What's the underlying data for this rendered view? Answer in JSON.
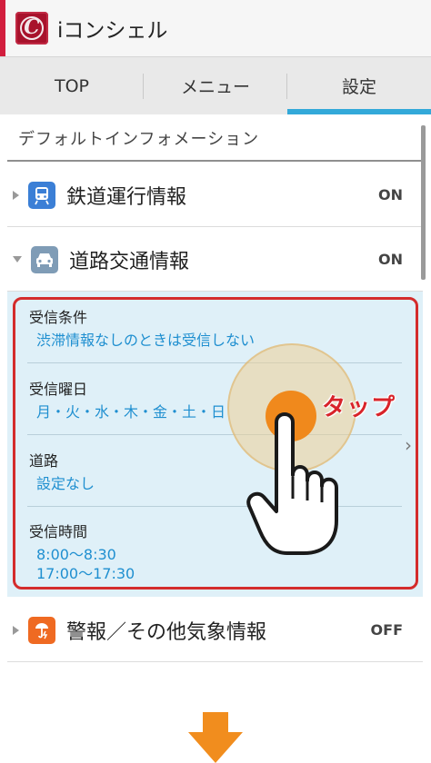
{
  "app": {
    "logo_letter": "C",
    "title": "iコンシェル"
  },
  "tabs": [
    {
      "label": "TOP",
      "active": false
    },
    {
      "label": "メニュー",
      "active": false
    },
    {
      "label": "設定",
      "active": true
    }
  ],
  "section": {
    "title": "デフォルトインフォメーション"
  },
  "rows": [
    {
      "label": "鉄道運行情報",
      "state": "ON",
      "icon": "train-icon",
      "expanded": false
    },
    {
      "label": "道路交通情報",
      "state": "ON",
      "icon": "car-icon",
      "expanded": true
    },
    {
      "label": "警報／その他気象情報",
      "state": "OFF",
      "icon": "weather-umbrella-icon",
      "expanded": false
    }
  ],
  "road_settings": {
    "condition_label": "受信条件",
    "condition_value": "渋滞情報なしのときは受信しない",
    "days_label": "受信曜日",
    "days_value": "月・火・水・木・金・土・日",
    "road_label": "道路",
    "road_value": "設定なし",
    "time_label": "受信時間",
    "time_value_1": "8:00〜8:30",
    "time_value_2": "17:00〜17:30"
  },
  "annotation": {
    "tap_label": "タップ"
  },
  "colors": {
    "accent_tab": "#33a9d9",
    "brand_red": "#a8122c",
    "highlight_frame": "#d42c2c",
    "value_text": "#1f8fd0",
    "panel_bg": "#dff0f8",
    "arrow": "#f18d1e"
  }
}
